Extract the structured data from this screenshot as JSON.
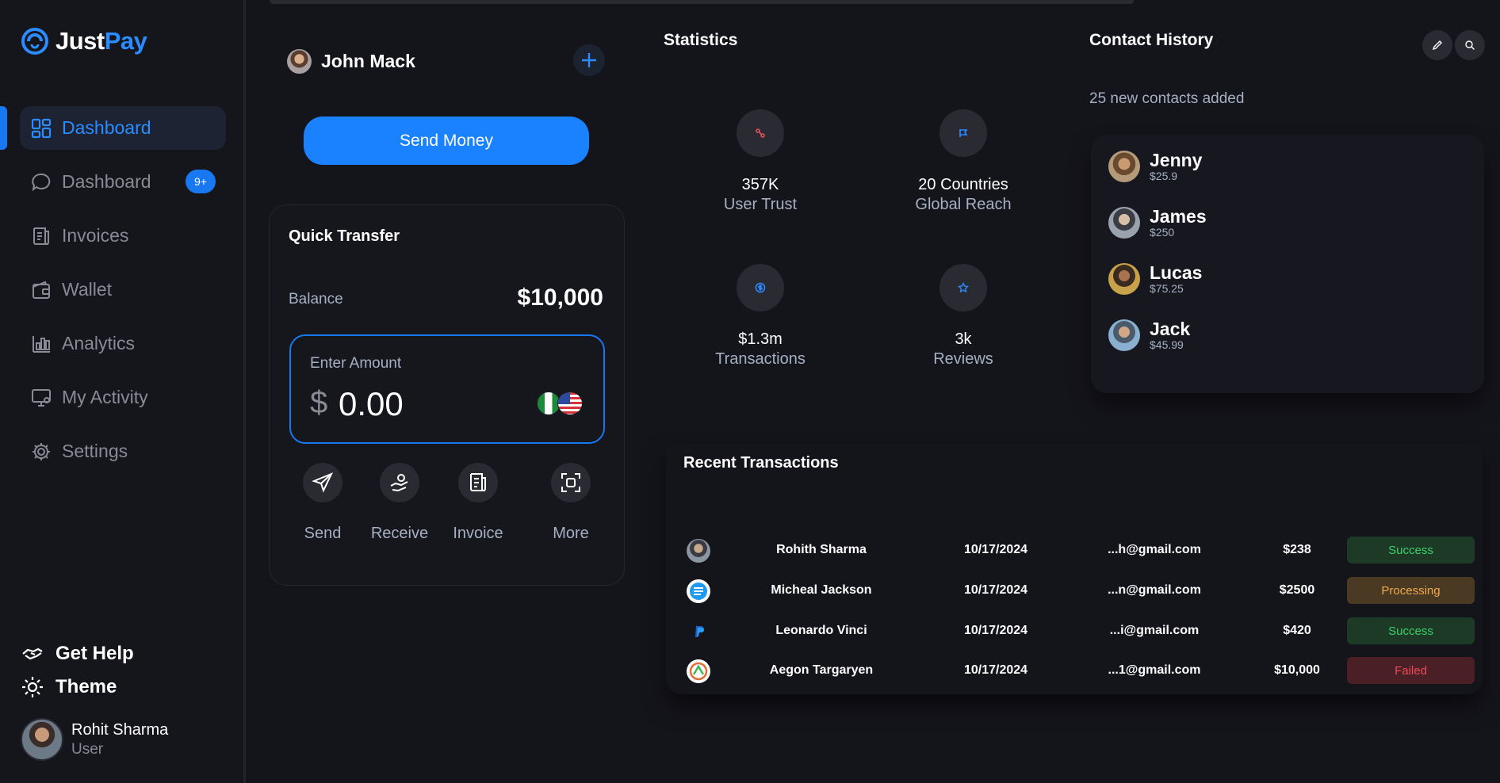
{
  "app": {
    "logo_just": "Just",
    "logo_pay": "Pay"
  },
  "sidebar": {
    "items": [
      {
        "label": "Dashboard",
        "icon": "grid-icon",
        "active": true
      },
      {
        "label": "Dashboard",
        "icon": "chat-icon",
        "badge": "9+"
      },
      {
        "label": "Invoices",
        "icon": "invoice-icon"
      },
      {
        "label": "Wallet",
        "icon": "wallet-icon"
      },
      {
        "label": "Analytics",
        "icon": "bar-chart-icon"
      },
      {
        "label": "My Activity",
        "icon": "monitor-icon"
      },
      {
        "label": "Settings",
        "icon": "gear-icon"
      }
    ],
    "help_label": "Get Help",
    "theme_label": "Theme",
    "user": {
      "name": "Rohit Sharma",
      "role": "User"
    }
  },
  "profile": {
    "name": "John Mack"
  },
  "send_money_label": "Send Money",
  "quick_transfer": {
    "title": "Quick Transfer",
    "balance_label": "Balance",
    "balance_value": "$10,000",
    "amount_label": "Enter Amount",
    "currency_symbol": "$",
    "amount_value": "0.00",
    "actions": [
      {
        "label": "Send",
        "icon": "send-icon"
      },
      {
        "label": "Receive",
        "icon": "receive-icon"
      },
      {
        "label": "Invoice",
        "icon": "invoice-icon"
      },
      {
        "label": "More",
        "icon": "scan-icon"
      }
    ]
  },
  "statistics": {
    "title": "Statistics",
    "items": [
      {
        "value": "357K",
        "label": "User Trust",
        "icon": "link-icon",
        "icon_color": "#e0505a"
      },
      {
        "value": "20 Countries",
        "label": "Global Reach",
        "icon": "flag-icon",
        "icon_color": "#2b8cff"
      },
      {
        "value": "$1.3m",
        "label": "Transactions",
        "icon": "dollar-icon",
        "icon_color": "#2b8cff"
      },
      {
        "value": "3k",
        "label": "Reviews",
        "icon": "star-icon",
        "icon_color": "#2b8cff"
      }
    ]
  },
  "contact_history": {
    "title": "Contact History",
    "subtitle": "25 new contacts added",
    "contacts": [
      {
        "name": "Jenny",
        "amount": "$25.9"
      },
      {
        "name": "James",
        "amount": "$250"
      },
      {
        "name": "Lucas",
        "amount": "$75.25"
      },
      {
        "name": "Jack",
        "amount": "$45.99"
      }
    ]
  },
  "recent_transactions": {
    "title": "Recent Transactions",
    "rows": [
      {
        "name": "Rohith Sharma",
        "date": "10/17/2024",
        "email": "...h@gmail.com",
        "amount": "$238",
        "status": "Success"
      },
      {
        "name": "Micheal Jackson",
        "date": "10/17/2024",
        "email": "...n@gmail.com",
        "amount": "$2500",
        "status": "Processing"
      },
      {
        "name": "Leonardo Vinci",
        "date": "10/17/2024",
        "email": "...i@gmail.com",
        "amount": "$420",
        "status": "Success"
      },
      {
        "name": "Aegon Targaryen",
        "date": "10/17/2024",
        "email": "...1@gmail.com",
        "amount": "$10,000",
        "status": "Failed"
      }
    ]
  },
  "colors": {
    "accent": "#1778f2",
    "background": "#14141b",
    "success": "#3bd26a",
    "processing": "#f0a94a",
    "failed": "#f04a5a"
  }
}
